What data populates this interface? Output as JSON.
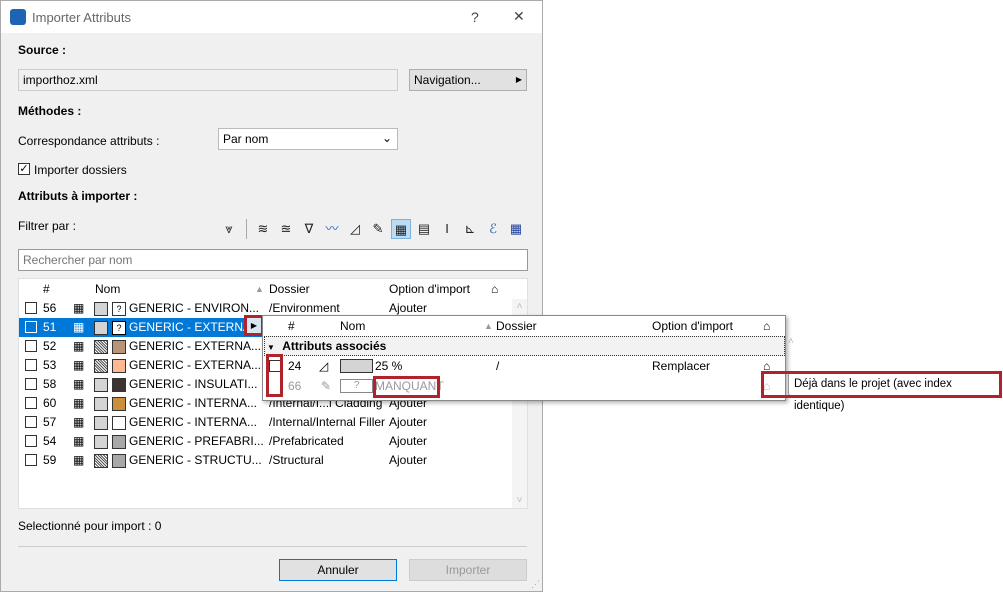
{
  "window": {
    "title": "Importer Attributs",
    "help": "?",
    "close": "✕"
  },
  "source": {
    "label": "Source :",
    "value": "importhoz.xml",
    "nav_button": "Navigation..."
  },
  "methods": {
    "label": "Méthodes :",
    "match_label": "Correspondance attributs :",
    "match_value": "Par nom",
    "import_folders": "Importer dossiers",
    "import_folders_checked": true
  },
  "attributes": {
    "label": "Attributs à importer :",
    "filter_label": "Filtrer par :",
    "search_placeholder": "Rechercher par nom",
    "filter_icons": [
      "filter-icon",
      "layer-icon",
      "layer-combination-icon",
      "pen-set-icon",
      "line-type-icon",
      "fill-icon",
      "surface-icon",
      "building-material-icon",
      "composite-icon",
      "profile-icon",
      "zone-category-icon",
      "mep-system-icon",
      "operation-profile-icon"
    ],
    "active_filter": "building-material-icon"
  },
  "table": {
    "headers": [
      "#",
      "Nom",
      "Dossier",
      "Option d'import"
    ],
    "rows": [
      {
        "id": "56",
        "name": "GENERIC - ENVIRON...",
        "folder": "/Environment",
        "option": "Ajouter",
        "fill": "dots",
        "color": "?"
      },
      {
        "id": "51",
        "name": "GENERIC - EXTERNA...",
        "folder": "",
        "option": "",
        "fill": "dots",
        "color": "?",
        "selected": true
      },
      {
        "id": "52",
        "name": "GENERIC - EXTERNA...",
        "folder": "",
        "option": "",
        "fill": "hatch",
        "color": "#b89478"
      },
      {
        "id": "53",
        "name": "GENERIC - EXTERNA...",
        "folder": "",
        "option": "",
        "fill": "hatch",
        "color": "#ffb890"
      },
      {
        "id": "58",
        "name": "GENERIC - INSULATI...",
        "folder": "",
        "option": "",
        "fill": "dots",
        "color": "#3d3330"
      },
      {
        "id": "60",
        "name": "GENERIC - INTERNA...",
        "folder": "/Internal/I...l Cladding",
        "option": "Ajouter",
        "fill": "dots",
        "color": "#cc8f3a"
      },
      {
        "id": "57",
        "name": "GENERIC - INTERNA...",
        "folder": "/Internal/Internal Filler",
        "option": "Ajouter",
        "fill": "dots",
        "color": "#ffffff"
      },
      {
        "id": "54",
        "name": "GENERIC - PREFABRI...",
        "folder": "/Prefabricated",
        "option": "Ajouter",
        "fill": "dots",
        "color": "#a8a8a8"
      },
      {
        "id": "59",
        "name": "GENERIC - STRUCTU...",
        "folder": "/Structural",
        "option": "Ajouter",
        "fill": "hatch",
        "color": "#a8a8a8"
      }
    ]
  },
  "popup": {
    "headers": [
      "#",
      "Nom",
      "Dossier",
      "Option d'import"
    ],
    "group": "Attributs associés",
    "rows": [
      {
        "id": "24",
        "name": "25 %",
        "folder": "/",
        "option": "Remplacer"
      },
      {
        "id": "66",
        "name": "MANQUANT",
        "folder": "",
        "option": ""
      }
    ]
  },
  "tooltip": "Déjà dans le projet (avec index identique)",
  "status": "Selectionné pour import : 0",
  "buttons": {
    "cancel": "Annuler",
    "import": "Importer"
  }
}
